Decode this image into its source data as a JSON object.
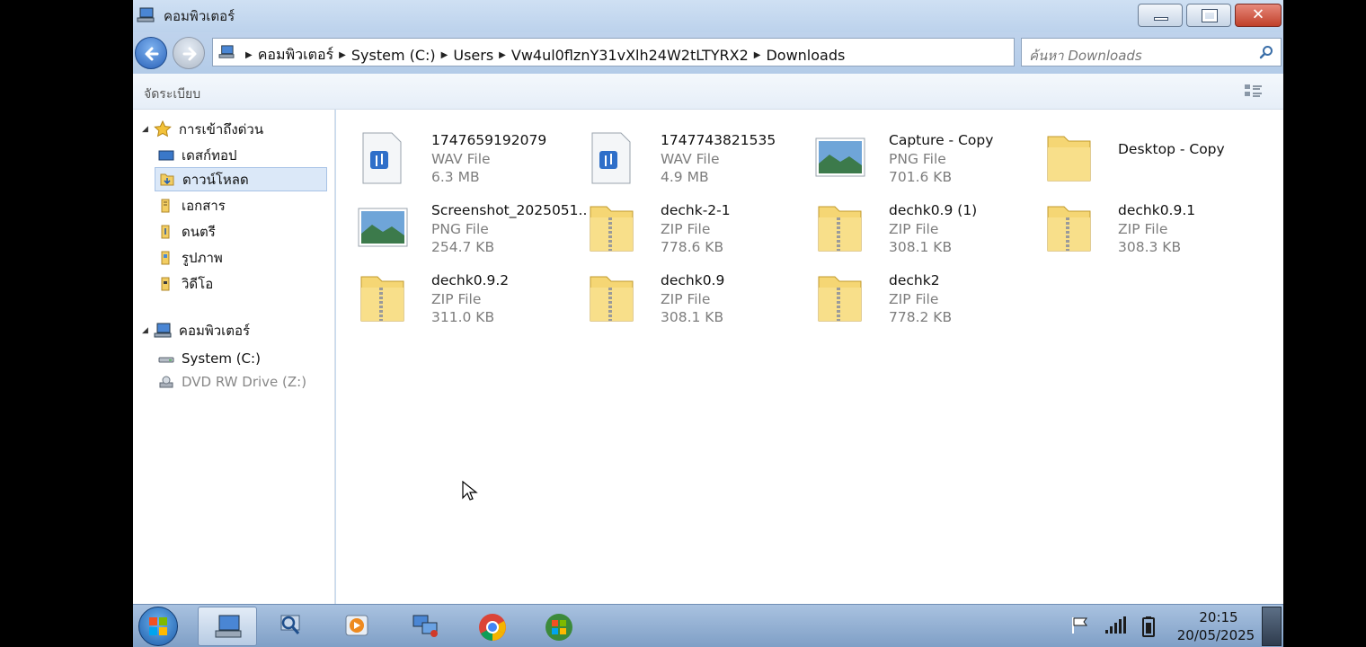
{
  "window": {
    "title": "คอมพิวเตอร์",
    "controls": {
      "minimize_icon": "minimize-icon",
      "maximize_icon": "restore-icon",
      "close_icon": "close-icon",
      "close_glyph": "✕"
    }
  },
  "nav": {
    "breadcrumbs": [
      "คอมพิวเตอร์",
      "System (C:)",
      "Users",
      "Vw4ul0flznY31vXlh24W2tLTYRX2",
      "Downloads"
    ],
    "search_placeholder": "ค้นหา Downloads"
  },
  "toolbar": {
    "organize_label": "จัดระเบียบ"
  },
  "sidebar": {
    "favorites_header": "การเข้าถึงด่วน",
    "favorites": [
      {
        "label": "เดสก์ทอป",
        "icon": "desktop-icon"
      },
      {
        "label": "ดาวน์โหลด",
        "icon": "downloads-folder-icon",
        "selected": true
      },
      {
        "label": "เอกสาร",
        "icon": "documents-folder-icon"
      },
      {
        "label": "ดนตรี",
        "icon": "music-folder-icon"
      },
      {
        "label": "รูปภาพ",
        "icon": "pictures-folder-icon"
      },
      {
        "label": "วิดีโอ",
        "icon": "videos-folder-icon"
      }
    ],
    "computer_header": "คอมพิวเตอร์",
    "drives": [
      {
        "label": "System (C:)",
        "icon": "hard-drive-icon"
      },
      {
        "label": "DVD RW Drive (Z:)",
        "icon": "dvd-drive-icon",
        "disabled": true
      }
    ]
  },
  "files": [
    {
      "name": "1747659192079",
      "type": "WAV File",
      "size": "6.3 MB",
      "icon": "audio-file-icon"
    },
    {
      "name": "1747743821535",
      "type": "WAV File",
      "size": "4.9 MB",
      "icon": "audio-file-icon"
    },
    {
      "name": "Capture - Copy",
      "type": "PNG File",
      "size": "701.6 KB",
      "icon": "image-file-icon"
    },
    {
      "name": "Desktop - Copy",
      "type": "",
      "size": "",
      "icon": "folder-icon"
    },
    {
      "name": "Screenshot_2025051...",
      "type": "PNG File",
      "size": "254.7 KB",
      "icon": "image-file-icon"
    },
    {
      "name": "dechk-2-1",
      "type": "ZIP File",
      "size": "778.6 KB",
      "icon": "zip-folder-icon"
    },
    {
      "name": "dechk0.9 (1)",
      "type": "ZIP File",
      "size": "308.1 KB",
      "icon": "zip-folder-icon"
    },
    {
      "name": "dechk0.9.1",
      "type": "ZIP File",
      "size": "308.3 KB",
      "icon": "zip-folder-icon"
    },
    {
      "name": "dechk0.9.2",
      "type": "ZIP File",
      "size": "311.0 KB",
      "icon": "zip-folder-icon"
    },
    {
      "name": "dechk0.9",
      "type": "ZIP File",
      "size": "308.1 KB",
      "icon": "zip-folder-icon"
    },
    {
      "name": "dechk2",
      "type": "ZIP File",
      "size": "778.2 KB",
      "icon": "zip-folder-icon"
    }
  ],
  "taskbar": {
    "apps": [
      "file-explorer-icon",
      "search-tool-icon",
      "media-player-icon",
      "network-icon",
      "chrome-icon",
      "windows-logo-icon"
    ],
    "clock_time": "20:15",
    "clock_date": "20/05/2025"
  }
}
